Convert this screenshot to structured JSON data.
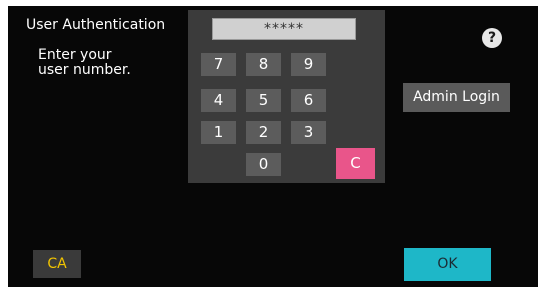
{
  "header": {
    "title": "User Authentication",
    "instruction_line1": "Enter your",
    "instruction_line2": "user number.",
    "help_icon": "?"
  },
  "keypad": {
    "display": "*****",
    "keys": {
      "k7": "7",
      "k8": "8",
      "k9": "9",
      "k4": "4",
      "k5": "5",
      "k6": "6",
      "k1": "1",
      "k2": "2",
      "k3": "3",
      "k0": "0",
      "clear": "C"
    }
  },
  "buttons": {
    "admin_login": "Admin Login",
    "clear_all": "CA",
    "ok": "OK"
  },
  "colors": {
    "background": "#070707",
    "keypad_panel": "#3b3b3b",
    "key": "#5c5c5c",
    "clear_key": "#e9558a",
    "ca_text": "#f2c400",
    "ok_button": "#1eb7c8"
  }
}
